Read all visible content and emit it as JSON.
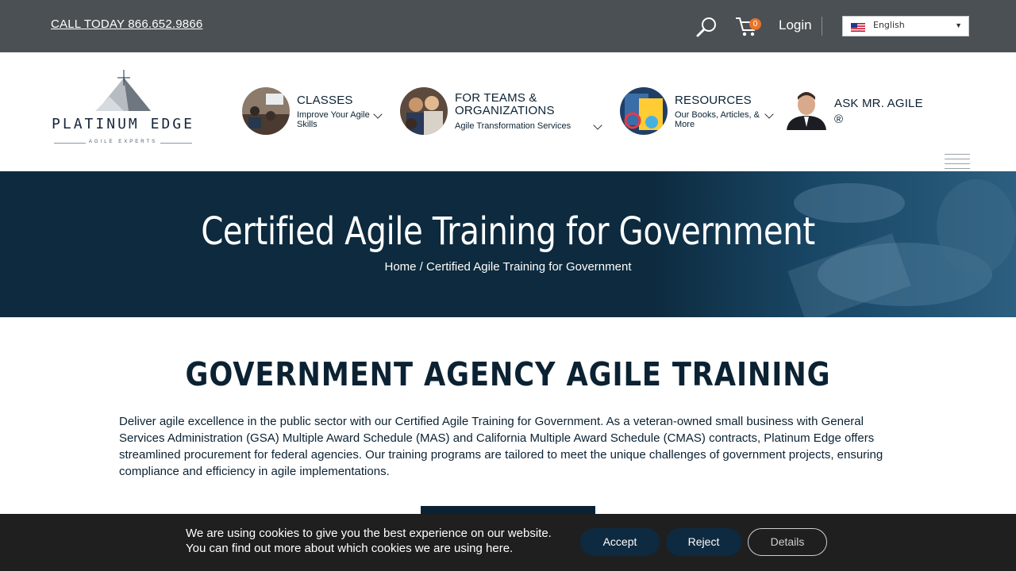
{
  "topbar": {
    "call": "CALL TODAY 866.652.9866",
    "cart_count": "0",
    "login": "Login",
    "language": "English"
  },
  "nav": {
    "logo_title": "PLATINUM EDGE",
    "logo_sub": "AGILE EXPERTS",
    "items": [
      {
        "title": "CLASSES",
        "sub": "Improve Your Agile Skills"
      },
      {
        "title": "FOR TEAMS & ORGANIZATIONS",
        "sub": "Agile Transformation Services"
      },
      {
        "title": "RESOURCES",
        "sub": "Our Books, Articles, & More"
      },
      {
        "title": "ASK MR. AGILE ®"
      }
    ]
  },
  "hero": {
    "title": "Certified Agile Training for Government",
    "crumb_home": "Home",
    "crumb_sep": " / ",
    "crumb_current": "Certified Agile Training for Government"
  },
  "main": {
    "section_title": "GOVERNMENT AGENCY AGILE TRAINING",
    "intro": "Deliver agile excellence in the public sector with our Certified Agile Training for Government. As a veteran-owned small business with General Services Administration (GSA) Multiple Award Schedule (MAS) and California Multiple Award Schedule (CMAS) contracts, Platinum Edge offers streamlined procurement for federal agencies. Our training programs are tailored to meet the unique challenges of government projects, ensuring compliance and efficiency in agile implementations."
  },
  "cookie": {
    "line1": "We are using cookies to give you the best experience on our website.",
    "line2": "You can find out more about which cookies we are using here.",
    "accept": "Accept",
    "reject": "Reject",
    "details": "Details"
  },
  "colors": {
    "topbar": "#4b5054",
    "navy": "#0b2233",
    "hero": "#0d2a3e",
    "badge": "#e8742a",
    "cookie": "#1f1f1f"
  },
  "icons": [
    "search-icon",
    "cart-icon",
    "us-flag-icon",
    "chevron-down-icon",
    "hamburger-icon"
  ]
}
